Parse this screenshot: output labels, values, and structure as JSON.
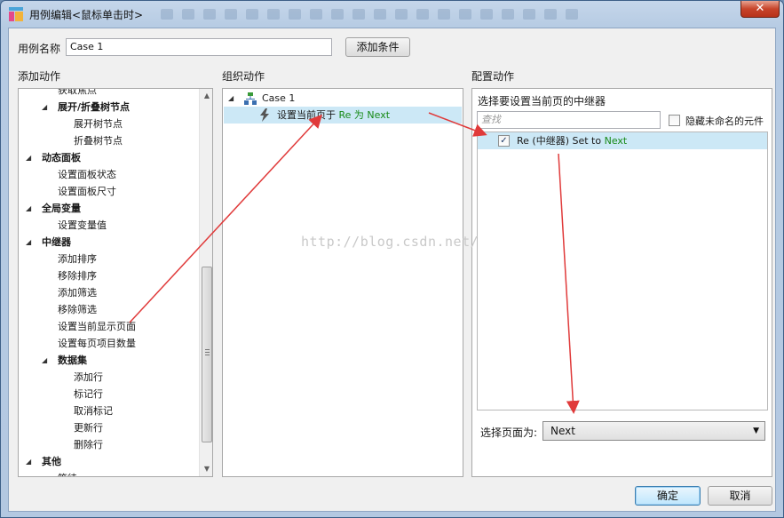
{
  "window": {
    "title": "用例编辑<鼠标单击时>",
    "close_glyph": "✕"
  },
  "case_name": {
    "label": "用例名称",
    "value": "Case 1",
    "add_condition_label": "添加条件"
  },
  "add_actions": {
    "header": "添加动作",
    "rows": [
      {
        "text": "获取焦点",
        "level": 2,
        "type": "item"
      },
      {
        "text": "展开/折叠树节点",
        "level": 2,
        "type": "group"
      },
      {
        "text": "展开树节点",
        "level": 3,
        "type": "item"
      },
      {
        "text": "折叠树节点",
        "level": 3,
        "type": "item"
      },
      {
        "text": "动态面板",
        "level": 1,
        "type": "category"
      },
      {
        "text": "设置面板状态",
        "level": 2,
        "type": "item"
      },
      {
        "text": "设置面板尺寸",
        "level": 2,
        "type": "item"
      },
      {
        "text": "全局变量",
        "level": 1,
        "type": "category"
      },
      {
        "text": "设置变量值",
        "level": 2,
        "type": "item"
      },
      {
        "text": "中继器",
        "level": 1,
        "type": "category"
      },
      {
        "text": "添加排序",
        "level": 2,
        "type": "item"
      },
      {
        "text": "移除排序",
        "level": 2,
        "type": "item"
      },
      {
        "text": "添加筛选",
        "level": 2,
        "type": "item"
      },
      {
        "text": "移除筛选",
        "level": 2,
        "type": "item"
      },
      {
        "text": "设置当前显示页面",
        "level": 2,
        "type": "item"
      },
      {
        "text": "设置每页项目数量",
        "level": 2,
        "type": "item"
      },
      {
        "text": "数据集",
        "level": 2,
        "type": "group"
      },
      {
        "text": "添加行",
        "level": 3,
        "type": "item"
      },
      {
        "text": "标记行",
        "level": 3,
        "type": "item"
      },
      {
        "text": "取消标记",
        "level": 3,
        "type": "item"
      },
      {
        "text": "更新行",
        "level": 3,
        "type": "item"
      },
      {
        "text": "删除行",
        "level": 3,
        "type": "item"
      },
      {
        "text": "其他",
        "level": 1,
        "type": "category"
      },
      {
        "text": "等待",
        "level": 2,
        "type": "item"
      }
    ]
  },
  "organize_actions": {
    "header": "组织动作",
    "case_label": "Case 1",
    "action_prefix": "设置当前页于 ",
    "action_target": "Re 为 Next"
  },
  "configure_actions": {
    "header": "配置动作",
    "subheader": "选择要设置当前页的中继器",
    "search_placeholder": "查找",
    "hide_unnamed_label": "隐藏未命名的元件",
    "repeater_item_prefix": "Re (中继器) Set to ",
    "repeater_item_value": "Next",
    "select_page_label": "选择页面为:",
    "select_page_value": "Next"
  },
  "footer": {
    "ok_label": "确定",
    "cancel_label": "取消"
  },
  "watermark": "http://blog.csdn.net/",
  "colors": {
    "selection": "#cce8f6",
    "arrow": "#e03a3a",
    "value_green": "#178a17"
  }
}
